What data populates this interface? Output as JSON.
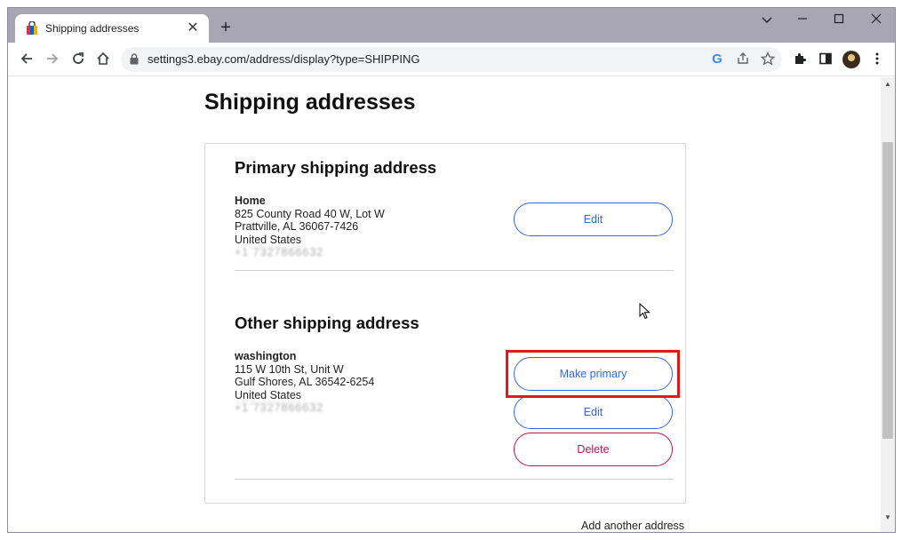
{
  "browser": {
    "tab_title": "Shipping addresses",
    "tab_close": "✕",
    "new_tab": "+",
    "url": "settings3.ebay.com/address/display?type=SHIPPING",
    "omnibox_google": "G",
    "icons": [
      "back-icon",
      "forward-icon",
      "reload-icon",
      "home-icon",
      "lock-icon",
      "google-icon",
      "share-icon",
      "star-icon",
      "extensions-icon",
      "side-panel-icon",
      "profile-avatar",
      "menu-icon"
    ]
  },
  "page": {
    "title": "Shipping addresses",
    "primary_section": {
      "heading": "Primary shipping address",
      "name": "Home",
      "line1": "825 County Road 40 W, Lot W",
      "line2": "Prattville, AL 36067-7426",
      "country": "United States",
      "phone": "+1 7327866632",
      "edit_label": "Edit"
    },
    "other_section": {
      "heading": "Other shipping address",
      "name": "washington",
      "line1": "115 W 10th St, Unit W",
      "line2": "Gulf Shores, AL 36542-6254",
      "country": "United States",
      "phone": "+1 7327866632",
      "make_primary_label": "Make primary",
      "edit_label": "Edit",
      "delete_label": "Delete"
    },
    "add_address_label": "Add another address"
  },
  "colors": {
    "button_blue": "#3665f3",
    "button_red": "#c3134c",
    "highlight_red": "#e01a1a",
    "tabstrip": "#a9a6b4"
  }
}
